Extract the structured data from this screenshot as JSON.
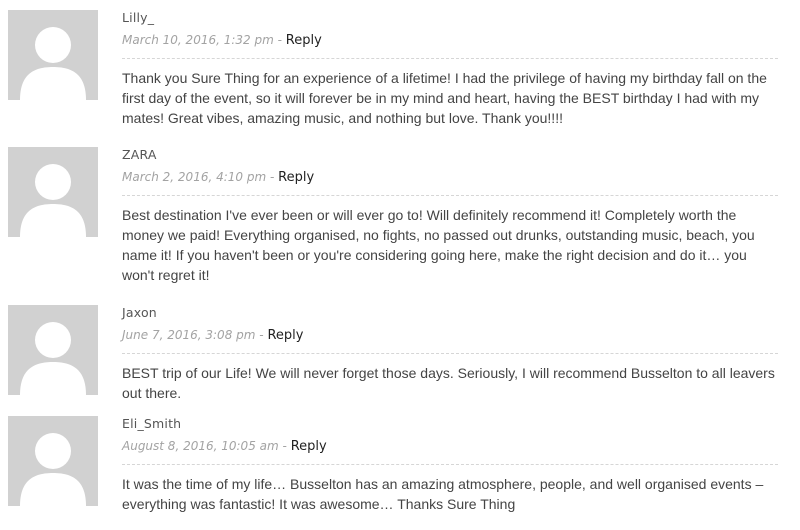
{
  "comments": [
    {
      "author": "Lilly_",
      "date": "March 10, 2016, 1:32 pm",
      "separator": "-",
      "reply_label": "Reply",
      "avatar_icon": "default-avatar-icon",
      "text": "Thank you Sure Thing for an experience of a lifetime! I had the privilege of having my birthday fall on the first day of the event, so it will forever be in my mind and heart, having the BEST birthday I had with my mates! Great vibes, amazing music, and nothing but love. Thank you!!!!"
    },
    {
      "author": "ZARA",
      "date": "March 2, 2016, 4:10 pm",
      "separator": "-",
      "reply_label": "Reply",
      "avatar_icon": "default-avatar-icon",
      "text": "Best destination I've ever been or will ever go to! Will definitely recommend it! Completely worth the money we paid! Everything organised, no fights, no passed out drunks, outstanding music, beach, you name it! If you haven't been or you're considering going here, make the right decision and do it… you won't regret it!"
    },
    {
      "author": "Jaxon",
      "date": "June 7, 2016, 3:08 pm",
      "separator": "-",
      "reply_label": "Reply",
      "avatar_icon": "default-avatar-icon",
      "text": "BEST trip of our Life! We will never forget those days. Seriously, I will recommend Busselton to all leavers out there."
    },
    {
      "author": "Eli_Smith",
      "date": "August 8, 2016, 10:05 am",
      "separator": "-",
      "reply_label": "Reply",
      "avatar_icon": "default-avatar-icon",
      "text": "It was the time of my life… Busselton has an amazing atmosphere, people, and well organised events – everything was fantastic! It was awesome… Thanks Sure Thing"
    }
  ]
}
